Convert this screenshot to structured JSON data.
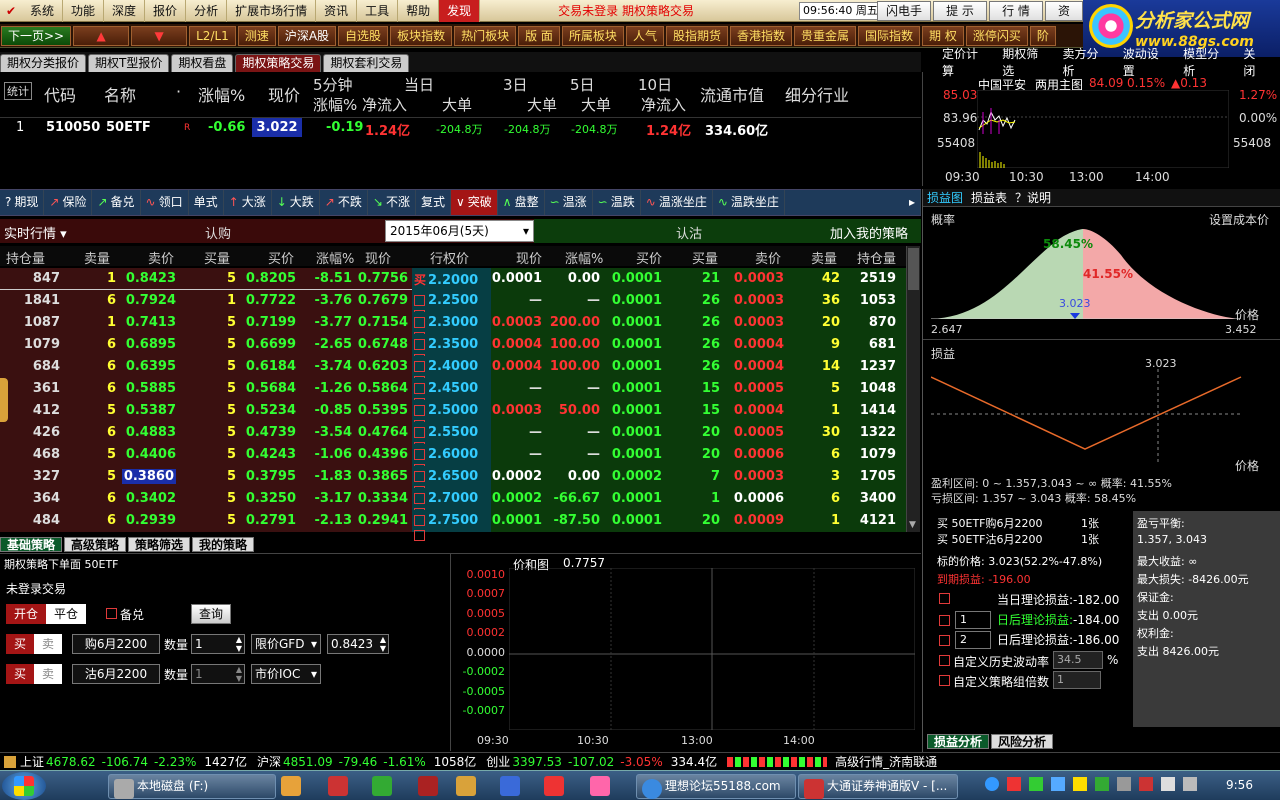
{
  "menubar": {
    "items": [
      "系统",
      "功能",
      "深度",
      "报价",
      "分析",
      "扩展市场行情",
      "资讯",
      "工具",
      "帮助",
      "发现"
    ],
    "banner": "交易未登录   期权策略交易",
    "clock": "09:56:40",
    "weekday": "周五",
    "right_buttons": [
      "闪电手",
      "提 示",
      "行 情",
      "资"
    ]
  },
  "watermark": {
    "title": "分析家公式网",
    "url": "www.88gs.com"
  },
  "toolbar2": {
    "items": [
      "下一页>>",
      "▲",
      "▼",
      "L2/L1",
      "测速",
      "沪深A股",
      "自选股",
      "板块指数",
      "热门板块",
      "版 面",
      "所属板块",
      "人气",
      "股指期货",
      "香港指数",
      "贵重金属",
      "国际指数",
      "期 权",
      "涨停闪买",
      "阶"
    ]
  },
  "tabs": [
    "期权分类报价",
    "期权T型报价",
    "期权看盘",
    "期权策略交易",
    "期权套利交易"
  ],
  "right_tabs": [
    "定价计算",
    "期权筛选",
    "卖方分析",
    "波动设置",
    "模型分析",
    "关闭"
  ],
  "quote": {
    "headers": {
      "stat": "统计",
      "code": "代码",
      "name": "名称",
      "dot": "·",
      "chg": "涨幅%",
      "price": "现价",
      "min5a": "5分钟",
      "min5b": "涨幅%",
      "day_label": "当日",
      "inflow": "净流入",
      "big": "大单",
      "d3": "3日",
      "d5": "5日",
      "d10": "10日",
      "inflow10": "净流入",
      "mv": "流通市值",
      "ind": "细分行业"
    },
    "row": {
      "idx": "1",
      "code": "510050",
      "name": "50ETF",
      "flag": "R",
      "chg": "-0.66",
      "price": "3.022",
      "min5": "-0.19",
      "inflow": "1.24亿",
      "big1": "-204.8万",
      "big3": "-204.8万",
      "big5": "-204.8万",
      "inflow10": "1.24亿",
      "mv": "334.60亿",
      "ind": ""
    }
  },
  "mini_chart": {
    "name": "中国平安",
    "chart_label": "两用主图",
    "price": "84.09",
    "pct": "0.15%",
    "chg": "▲0.13",
    "y_left": [
      "85.03",
      "83.96",
      "55408"
    ],
    "y_right": [
      "1.27%",
      "0.00%",
      "55408"
    ],
    "x_labels": [
      "09:30",
      "10:30",
      "13:00",
      "14:00"
    ]
  },
  "strategy_toolbar": [
    "期现",
    "保险",
    "备兑",
    "领口",
    "单式",
    "大涨",
    "大跌",
    "不跌",
    "不涨",
    "复式",
    "突破",
    "盘整",
    "温涨",
    "温跌",
    "温涨坐庄",
    "温跌坐庄"
  ],
  "options": {
    "mode": "实时行情",
    "call_label": "认购",
    "expiry": "2015年06月(5天)",
    "put_label": "认沽",
    "add_strategy": "加入我的策略",
    "headers_left": [
      "持仓量",
      "卖量",
      "卖价",
      "买量",
      "买价",
      "涨幅%",
      "现价"
    ],
    "header_mid": "行权价",
    "headers_right": [
      "现价",
      "涨幅%",
      "买价",
      "买量",
      "卖价",
      "卖量",
      "持仓量"
    ],
    "rows": [
      {
        "oi": "847",
        "sv": "1",
        "sp": "0.8423",
        "bv": "5",
        "bp": "0.8205",
        "chg": "-8.51",
        "px": "0.7756",
        "k": "2.2000",
        "selected": true,
        "ppx": "0.0001",
        "pchg": "0.00",
        "pbp": "0.0001",
        "pbv": "21",
        "psp": "0.0003",
        "psv": "42",
        "poi": "2519"
      },
      {
        "oi": "1841",
        "sv": "6",
        "sp": "0.7924",
        "bv": "1",
        "bp": "0.7722",
        "chg": "-3.76",
        "px": "0.7679",
        "k": "2.2500",
        "ppx": "—",
        "pchg": "—",
        "pbp": "0.0001",
        "pbv": "26",
        "psp": "0.0003",
        "psv": "36",
        "poi": "1053"
      },
      {
        "oi": "1087",
        "sv": "1",
        "sp": "0.7413",
        "bv": "5",
        "bp": "0.7199",
        "chg": "-3.77",
        "px": "0.7154",
        "k": "2.3000",
        "ppx": "0.0003",
        "pchg": "200.00",
        "pbp": "0.0001",
        "pbv": "26",
        "psp": "0.0003",
        "psv": "20",
        "poi": "870"
      },
      {
        "oi": "1079",
        "sv": "6",
        "sp": "0.6895",
        "bv": "5",
        "bp": "0.6699",
        "chg": "-2.65",
        "px": "0.6748",
        "k": "2.3500",
        "ppx": "0.0004",
        "pchg": "100.00",
        "pbp": "0.0001",
        "pbv": "26",
        "psp": "0.0004",
        "psv": "9",
        "poi": "681"
      },
      {
        "oi": "684",
        "sv": "6",
        "sp": "0.6395",
        "bv": "5",
        "bp": "0.6184",
        "chg": "-3.74",
        "px": "0.6203",
        "k": "2.4000",
        "ppx": "0.0004",
        "pchg": "100.00",
        "pbp": "0.0001",
        "pbv": "26",
        "psp": "0.0004",
        "psv": "14",
        "poi": "1237"
      },
      {
        "oi": "361",
        "sv": "6",
        "sp": "0.5885",
        "bv": "5",
        "bp": "0.5684",
        "chg": "-1.26",
        "px": "0.5864",
        "k": "2.4500",
        "ppx": "—",
        "pchg": "—",
        "pbp": "0.0001",
        "pbv": "15",
        "psp": "0.0005",
        "psv": "5",
        "poi": "1048"
      },
      {
        "oi": "412",
        "sv": "5",
        "sp": "0.5387",
        "bv": "5",
        "bp": "0.5234",
        "chg": "-0.85",
        "px": "0.5395",
        "k": "2.5000",
        "ppx": "0.0003",
        "pchg": "50.00",
        "pbp": "0.0001",
        "pbv": "15",
        "psp": "0.0004",
        "psv": "1",
        "poi": "1414"
      },
      {
        "oi": "426",
        "sv": "6",
        "sp": "0.4883",
        "bv": "5",
        "bp": "0.4739",
        "chg": "-3.54",
        "px": "0.4764",
        "k": "2.5500",
        "ppx": "—",
        "pchg": "—",
        "pbp": "0.0001",
        "pbv": "20",
        "psp": "0.0005",
        "psv": "30",
        "poi": "1322"
      },
      {
        "oi": "468",
        "sv": "5",
        "sp": "0.4406",
        "bv": "5",
        "bp": "0.4243",
        "chg": "-1.06",
        "px": "0.4396",
        "k": "2.6000",
        "ppx": "—",
        "pchg": "—",
        "pbp": "0.0001",
        "pbv": "20",
        "psp": "0.0006",
        "psv": "6",
        "poi": "1079"
      },
      {
        "oi": "327",
        "sv": "5",
        "sp": "0.3860",
        "bv": "5",
        "bp": "0.3795",
        "chg": "-1.83",
        "px": "0.3865",
        "k": "2.6500",
        "ppx": "0.0002",
        "pchg": "0.00",
        "pbp": "0.0002",
        "pbv": "7",
        "psp": "0.0003",
        "psv": "3",
        "poi": "1705",
        "sp_hl": true
      },
      {
        "oi": "364",
        "sv": "6",
        "sp": "0.3402",
        "bv": "5",
        "bp": "0.3250",
        "chg": "-3.17",
        "px": "0.3334",
        "k": "2.7000",
        "ppx": "0.0002",
        "pchg": "-66.67",
        "pbp": "0.0001",
        "pbv": "1",
        "psp": "0.0006",
        "psv": "6",
        "poi": "3400"
      },
      {
        "oi": "484",
        "sv": "6",
        "sp": "0.2939",
        "bv": "5",
        "bp": "0.2791",
        "chg": "-2.13",
        "px": "0.2941",
        "k": "2.7500",
        "ppx": "0.0001",
        "pchg": "-87.50",
        "pbp": "0.0001",
        "pbv": "20",
        "psp": "0.0009",
        "psv": "1",
        "poi": "4121"
      }
    ]
  },
  "right_panel": {
    "tabs": [
      "损益图",
      "损益表",
      "？说明"
    ],
    "prob_label": "概率",
    "set_cost": "设置成本价",
    "price_label": "价格",
    "prob_left_pct": "58.45%",
    "prob_right_pct": "41.55%",
    "marker": "3.023",
    "x_min": "2.647",
    "x_max": "3.452",
    "pnl_label": "损益",
    "pnl_marker": "3.023",
    "profit_range": "盈利区间: 0 ~ 1.357,3.043 ~ ∞   概率: 41.55%",
    "loss_range": "亏损区间: 1.357 ~ 3.043   概率: 58.45%",
    "legs": [
      {
        "text": "买 50ETF购6月2200",
        "qty": "1张"
      },
      {
        "text": "买 50ETF沽6月2200",
        "qty": "1张"
      }
    ],
    "underlying": "标的价格: 3.023(52.2%-47.8%)",
    "expiry_pnl": "到期损益: -196.00",
    "theory": [
      {
        "label": "当日理论损益:",
        "val": "-182.00",
        "day": ""
      },
      {
        "label": "日后理论损益:",
        "val": "-184.00",
        "day": "1"
      },
      {
        "label": "日后理论损益:",
        "val": "-186.00",
        "day": "2"
      }
    ],
    "custom_vol": "自定义历史波动率",
    "vol_val": "34.5",
    "pct_sign": "%",
    "custom_count": "自定义策略组倍数",
    "count_val": "1",
    "summary": {
      "breakeven_label": "盈亏平衡:",
      "breakeven": "1.357, 3.043",
      "max_gain": "最大收益: ∞",
      "max_loss": "最大损失: -8426.00元",
      "margin_label": "保证金:",
      "margin": "支出 0.00元",
      "premium_label": "权利金:",
      "premium": "支出 8426.00元"
    },
    "bottom_tabs": [
      "损益分析",
      "风险分析"
    ]
  },
  "bottom_tabs": [
    "基础策略",
    "高级策略",
    "策略筛选",
    "我的策略"
  ],
  "order": {
    "title": "期权策略下单面   50ETF",
    "status": "未登录交易",
    "open": "开仓",
    "close": "平仓",
    "covered": "备兑",
    "query": "查询",
    "leg1": {
      "buy": "买",
      "sell": "卖",
      "contract": "购6月2200",
      "qty_label": "数量",
      "qty": "1",
      "type": "限价GFD",
      "price": "0.8423"
    },
    "leg2": {
      "buy": "买",
      "sell": "卖",
      "contract": "沽6月2200",
      "qty_label": "数量",
      "qty": "1",
      "type": "市价IOC"
    }
  },
  "sum_chart": {
    "label": "价和图",
    "value": "0.7757",
    "y_labels": [
      "0.0010",
      "0.0007",
      "0.0005",
      "0.0002",
      "0.0000",
      "-0.0002",
      "-0.0005",
      "-0.0007"
    ],
    "x_labels": [
      "09:30",
      "10:30",
      "13:00",
      "14:00"
    ]
  },
  "status_bar": {
    "sh_label": "上证",
    "sh": "4678.62",
    "sh_chg": "-106.74",
    "sh_pct": "-2.23%",
    "sh_amt": "1427亿",
    "hs_label": "沪深",
    "hs": "4851.09",
    "hs_chg": "-79.46",
    "hs_pct": "-1.61%",
    "hs_amt": "1058亿",
    "cy_label": "创业",
    "cy": "3397.53",
    "cy_chg": "-107.02",
    "cy_pct": "-3.05%",
    "cy_amt": "334.4亿",
    "right": "高级行情_济南联通"
  },
  "taskbar": {
    "tasks": [
      "本地磁盘 (F:)",
      "理想论坛55188.com",
      "大通证券神通版V - [..."
    ],
    "time": "9:56"
  }
}
